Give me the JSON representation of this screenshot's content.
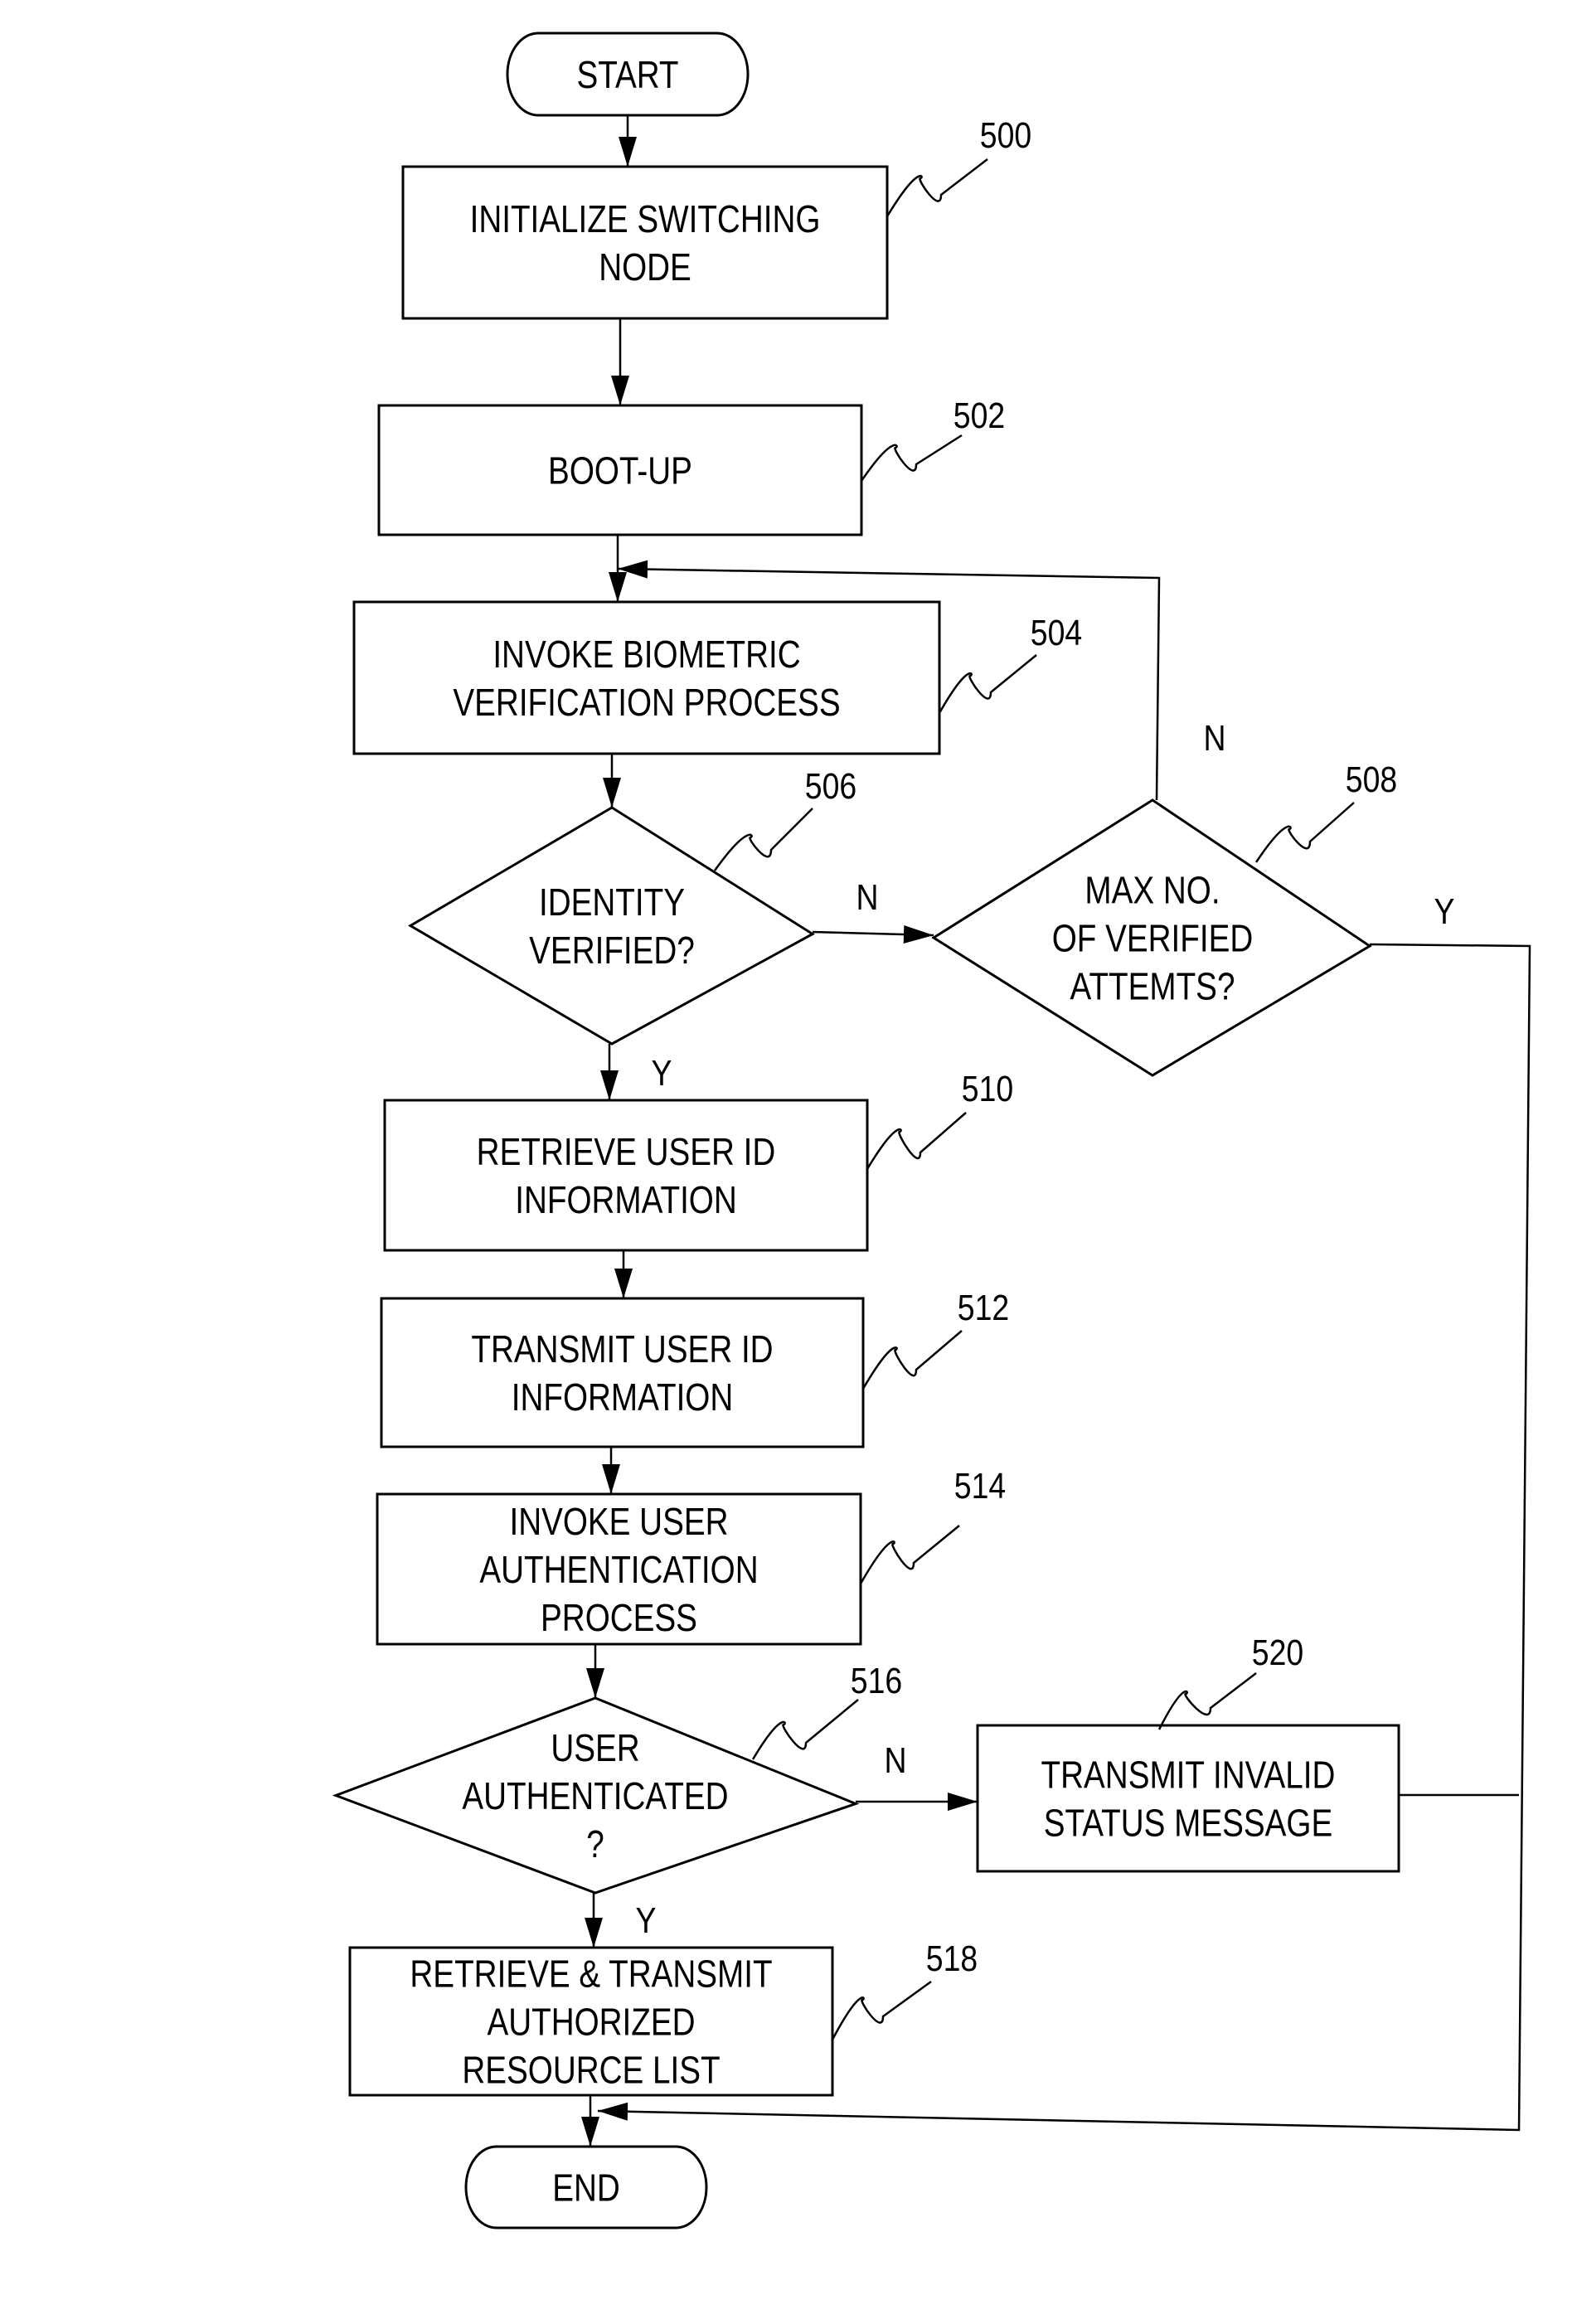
{
  "figure": {
    "nodes": [
      {
        "id": "start",
        "type": "terminal",
        "lines": [
          "START"
        ]
      },
      {
        "id": "500",
        "type": "process",
        "ref": "500",
        "lines": [
          "INITIALIZE SWITCHING",
          "NODE"
        ]
      },
      {
        "id": "502",
        "type": "process",
        "ref": "502",
        "lines": [
          "BOOT-UP"
        ]
      },
      {
        "id": "504",
        "type": "process",
        "ref": "504",
        "lines": [
          "INVOKE BIOMETRIC",
          "VERIFICATION PROCESS"
        ]
      },
      {
        "id": "506",
        "type": "decision",
        "ref": "506",
        "lines": [
          "IDENTITY",
          "VERIFIED?"
        ]
      },
      {
        "id": "508",
        "type": "decision",
        "ref": "508",
        "lines": [
          "MAX NO.",
          "OF VERIFIED",
          "ATTEMTS?"
        ]
      },
      {
        "id": "510",
        "type": "process",
        "ref": "510",
        "lines": [
          "RETRIEVE USER ID",
          "INFORMATION"
        ]
      },
      {
        "id": "512",
        "type": "process",
        "ref": "512",
        "lines": [
          "TRANSMIT USER ID",
          "INFORMATION"
        ]
      },
      {
        "id": "514",
        "type": "process",
        "ref": "514",
        "lines": [
          "INVOKE USER",
          "AUTHENTICATION",
          "PROCESS"
        ]
      },
      {
        "id": "516",
        "type": "decision",
        "ref": "516",
        "lines": [
          "USER",
          "AUTHENTICATED",
          "?"
        ]
      },
      {
        "id": "518",
        "type": "process",
        "ref": "518",
        "lines": [
          "RETRIEVE & TRANSMIT",
          "AUTHORIZED",
          "RESOURCE LIST"
        ]
      },
      {
        "id": "520",
        "type": "process",
        "ref": "520",
        "lines": [
          "TRANSMIT INVALID",
          "STATUS MESSAGE"
        ]
      },
      {
        "id": "end",
        "type": "terminal",
        "lines": [
          "END"
        ]
      }
    ],
    "edges": [
      {
        "from": "start",
        "to": "500",
        "label": ""
      },
      {
        "from": "500",
        "to": "502",
        "label": ""
      },
      {
        "from": "502",
        "to": "504",
        "label": ""
      },
      {
        "from": "504",
        "to": "506",
        "label": ""
      },
      {
        "from": "506",
        "to": "508",
        "label": "N"
      },
      {
        "from": "508",
        "to": "504",
        "label": "N"
      },
      {
        "from": "506",
        "to": "510",
        "label": "Y"
      },
      {
        "from": "508",
        "to": "end",
        "label": "Y"
      },
      {
        "from": "510",
        "to": "512",
        "label": ""
      },
      {
        "from": "512",
        "to": "514",
        "label": ""
      },
      {
        "from": "514",
        "to": "516",
        "label": ""
      },
      {
        "from": "516",
        "to": "520",
        "label": "N"
      },
      {
        "from": "516",
        "to": "518",
        "label": "Y"
      },
      {
        "from": "520",
        "to": "end",
        "label": ""
      },
      {
        "from": "518",
        "to": "end",
        "label": ""
      }
    ]
  }
}
